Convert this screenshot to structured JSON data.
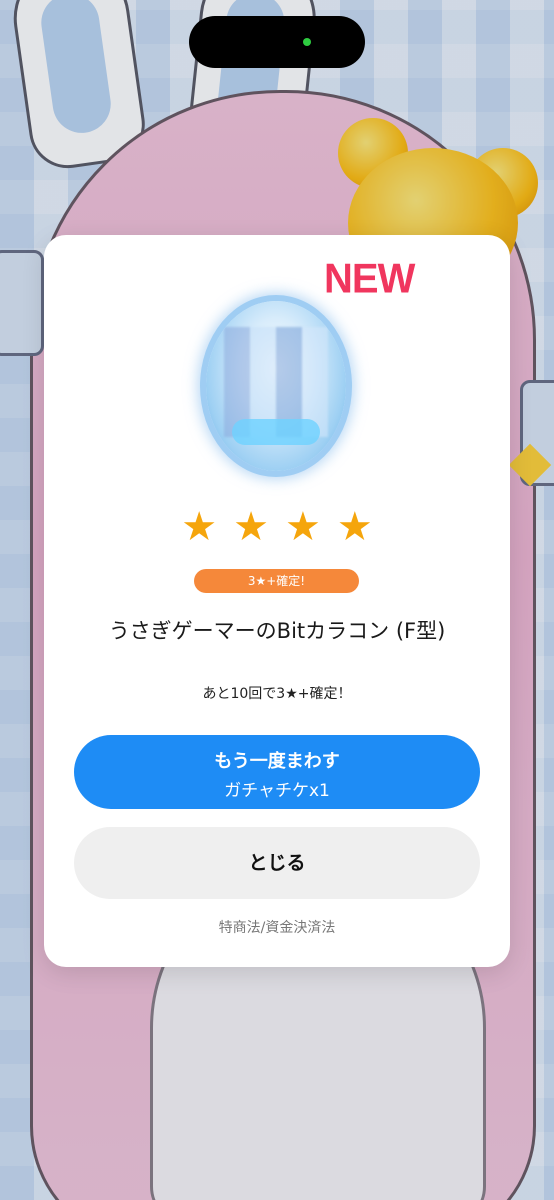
{
  "modal": {
    "new_badge": "NEW",
    "stars": [
      "★",
      "★",
      "★",
      "★"
    ],
    "guarantee_badge": "3★+確定!",
    "item_name": "うさぎゲーマーのBitカラコン (F型)",
    "remaining_note": "あと10回で3★+確定！",
    "spin_again_label": "もう一度まわす",
    "spin_again_cost": "ガチャチケx1",
    "close_label": "とじる",
    "legal_link": "特商法/資金決済法"
  },
  "colors": {
    "new_badge": "#f0365e",
    "star": "#f5a50c",
    "guarantee_badge_bg": "#f5883a",
    "primary_button": "#1e8cf5",
    "secondary_button": "#efefef",
    "legal_link": "#777777"
  }
}
